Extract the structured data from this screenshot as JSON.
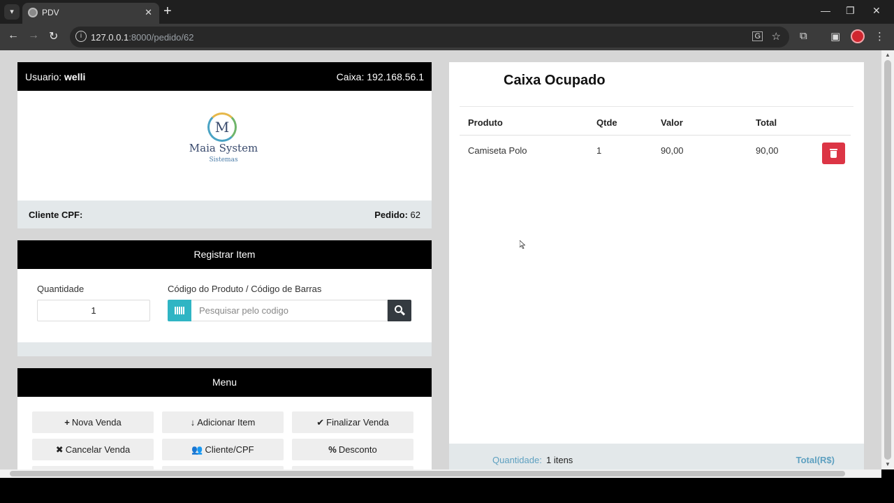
{
  "browser": {
    "tab_title": "PDV",
    "tab_close": "✕",
    "new_tab": "+",
    "url_host": "127.0.0.1",
    "url_path": ":8000/pedido/62",
    "minimize": "—",
    "restore": "❐",
    "close": "✕"
  },
  "header": {
    "user_label": "Usuario: ",
    "user_name": "welli",
    "caixa": "Caixa: 192.168.56.1"
  },
  "logo": {
    "letter": "M",
    "name": "Maia System",
    "sub": "Sistemas"
  },
  "client": {
    "cpf_label": "Cliente CPF:",
    "pedido_label": "Pedido:",
    "pedido_value": "62"
  },
  "register": {
    "title": "Registrar Item",
    "quantity_label": "Quantidade",
    "quantity_value": "1",
    "code_label": "Código do Produto / Código de Barras",
    "search_placeholder": "Pesquisar pelo codigo"
  },
  "menu": {
    "title": "Menu",
    "buttons": [
      {
        "icon": "+",
        "label": "Nova Venda"
      },
      {
        "icon": "↓",
        "label": "Adicionar Item"
      },
      {
        "icon": "✔",
        "label": "Finalizar Venda"
      },
      {
        "icon": "✖",
        "label": "Cancelar Venda"
      },
      {
        "icon": "👥",
        "label": "Cliente/CPF"
      },
      {
        "icon": "%",
        "label": "Desconto"
      }
    ]
  },
  "order": {
    "status": "Caixa Ocupado",
    "columns": [
      "Produto",
      "Qtde",
      "Valor",
      "Total"
    ],
    "rows": [
      {
        "produto": "Camiseta Polo",
        "qtde": "1",
        "valor": "90,00",
        "total": "90,00"
      }
    ],
    "quantity_label": "Quantidade:",
    "quantity_value": "1 itens",
    "total_label": "Total(R$)"
  },
  "colors": {
    "accent_teal": "#2fb5c4",
    "danger": "#dc3545",
    "dark": "#343a40"
  }
}
